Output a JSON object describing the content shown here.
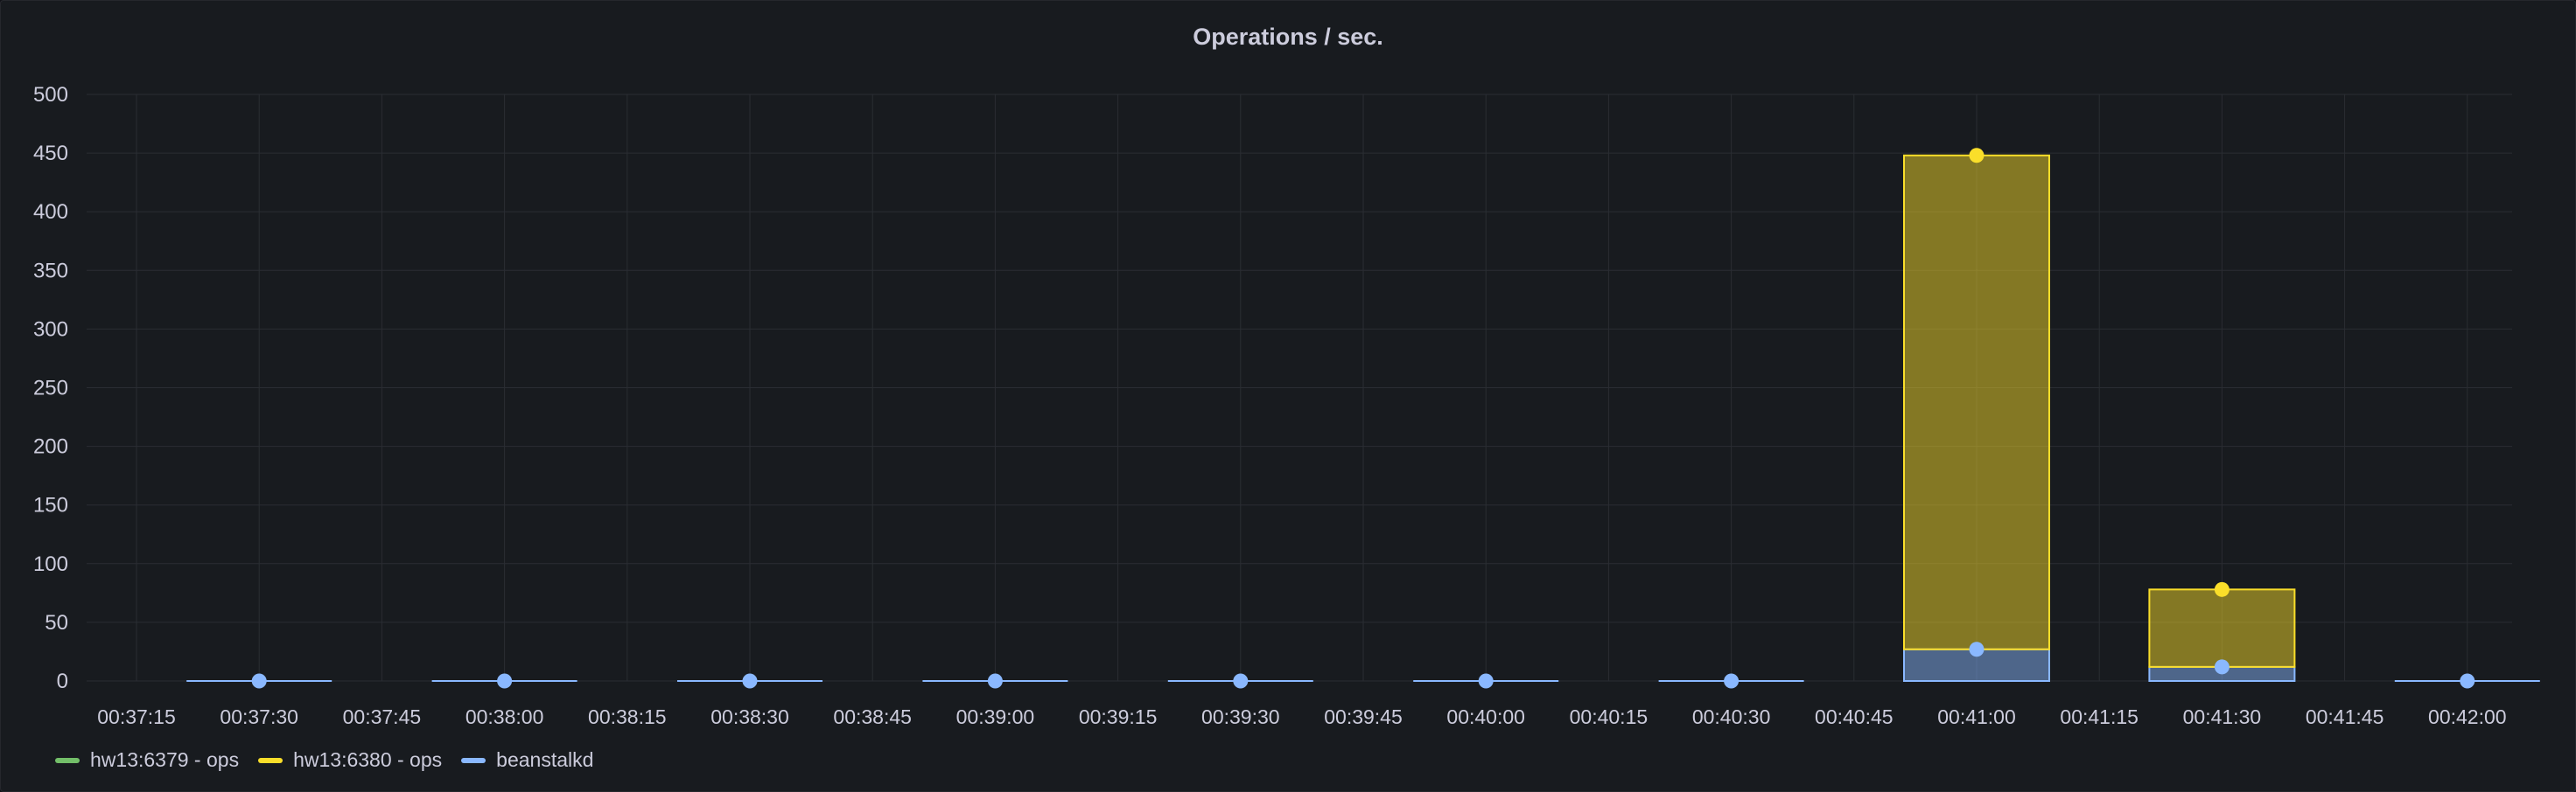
{
  "panel": {
    "title": "Operations / sec."
  },
  "colors": {
    "hw13_6379": "#73bf69",
    "hw13_6380": "#fade2a",
    "beanstalkd": "#8ab8ff",
    "grid": "#2a2d33",
    "text": "#ccccdc"
  },
  "legend": [
    {
      "name": "hw13:6379 - ops",
      "color": "#73bf69"
    },
    {
      "name": "hw13:6380 - ops",
      "color": "#fade2a"
    },
    {
      "name": "beanstalkd",
      "color": "#8ab8ff"
    }
  ],
  "chart_data": {
    "type": "bar",
    "stacked": true,
    "ylim": [
      0,
      500
    ],
    "yticks": [
      0,
      50,
      100,
      150,
      200,
      250,
      300,
      350,
      400,
      450,
      500
    ],
    "xticks": [
      "00:37:15",
      "00:37:30",
      "00:37:45",
      "00:38:00",
      "00:38:15",
      "00:38:30",
      "00:38:45",
      "00:39:00",
      "00:39:15",
      "00:39:30",
      "00:39:45",
      "00:40:00",
      "00:40:15",
      "00:40:30",
      "00:40:45",
      "00:41:00",
      "00:41:15",
      "00:41:30",
      "00:41:45",
      "00:42:00"
    ],
    "categories": [
      "00:37:30",
      "00:38:00",
      "00:38:30",
      "00:39:00",
      "00:39:30",
      "00:40:00",
      "00:40:30",
      "00:41:00",
      "00:41:30",
      "00:42:00"
    ],
    "series": [
      {
        "name": "hw13:6379 - ops",
        "values": [
          0,
          0,
          0,
          0,
          0,
          0,
          0,
          0,
          0,
          0
        ]
      },
      {
        "name": "hw13:6380 - ops",
        "values": [
          0,
          0,
          0,
          0,
          0,
          0,
          0,
          421,
          66,
          0
        ]
      },
      {
        "name": "beanstalkd",
        "values": [
          0,
          0,
          0,
          0,
          0,
          0,
          0,
          27,
          12,
          0
        ]
      }
    ],
    "grid": true,
    "legend_position": "bottom-left"
  }
}
